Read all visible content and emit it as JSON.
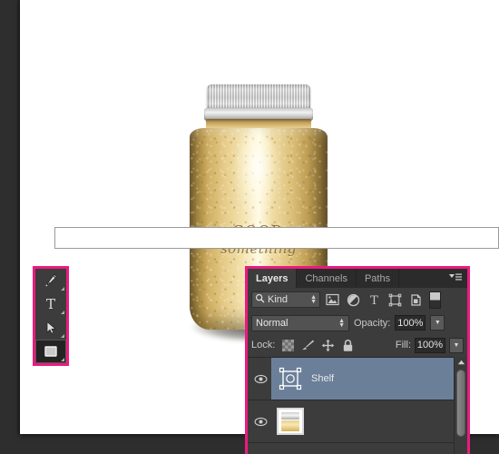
{
  "canvas": {
    "artwork": {
      "name": "gold-mason-jar",
      "emboss_line1": "GOOD",
      "emboss_line2": "something"
    }
  },
  "options_bar": {
    "value": "",
    "placeholder": ""
  },
  "toolbar": {
    "tools": [
      {
        "name": "pen-tool",
        "label": "Pen Tool",
        "selected": false,
        "has_flyout": true
      },
      {
        "name": "type-tool",
        "label": "Horizontal Type Tool",
        "selected": false,
        "has_flyout": true
      },
      {
        "name": "path-selection-tool",
        "label": "Path Selection Tool",
        "selected": false,
        "has_flyout": true
      },
      {
        "name": "rectangle-tool",
        "label": "Rectangle Tool",
        "selected": true,
        "has_flyout": true
      }
    ]
  },
  "layers_panel": {
    "tabs": [
      {
        "label": "Layers",
        "active": true
      },
      {
        "label": "Channels",
        "active": false
      },
      {
        "label": "Paths",
        "active": false
      }
    ],
    "menu_icon": "panel-menu-icon",
    "filter": {
      "kind_label": "Kind",
      "search_icon": "search-icon",
      "icons": [
        {
          "name": "filter-pixel-icon",
          "label": "Filter for pixel layers"
        },
        {
          "name": "filter-adjustment-icon",
          "label": "Filter for adjustment layers"
        },
        {
          "name": "filter-type-icon",
          "label": "Filter for type layers"
        },
        {
          "name": "filter-shape-icon",
          "label": "Filter for shape layers"
        },
        {
          "name": "filter-smart-object-icon",
          "label": "Filter for smart objects"
        }
      ],
      "toggle_label": "Turn filtering on/off"
    },
    "blend": {
      "mode": "Normal",
      "opacity_label": "Opacity:",
      "opacity_value": "100%"
    },
    "lock": {
      "label": "Lock:",
      "icons": [
        {
          "name": "lock-transparency-icon",
          "label": "Lock transparent pixels"
        },
        {
          "name": "lock-pixels-icon",
          "label": "Lock image pixels"
        },
        {
          "name": "lock-position-icon",
          "label": "Lock position"
        },
        {
          "name": "lock-all-icon",
          "label": "Lock all"
        }
      ],
      "fill_label": "Fill:",
      "fill_value": "100%"
    },
    "layers": [
      {
        "name": "Shelf",
        "visible": true,
        "selected": true,
        "thumb_type": "shape"
      },
      {
        "name": "",
        "visible": true,
        "selected": false,
        "thumb_type": "image"
      }
    ],
    "scrollbar": {
      "up_arrow": "scroll-up-arrow"
    }
  },
  "colors": {
    "highlight_border": "#ec1a7f",
    "panel_bg": "#3c3c3c",
    "layer_selected": "#6b7f99",
    "tab_bar": "#2b2b2b",
    "canvas_bg": "#ffffff",
    "app_bg": "#2e2e2e"
  }
}
